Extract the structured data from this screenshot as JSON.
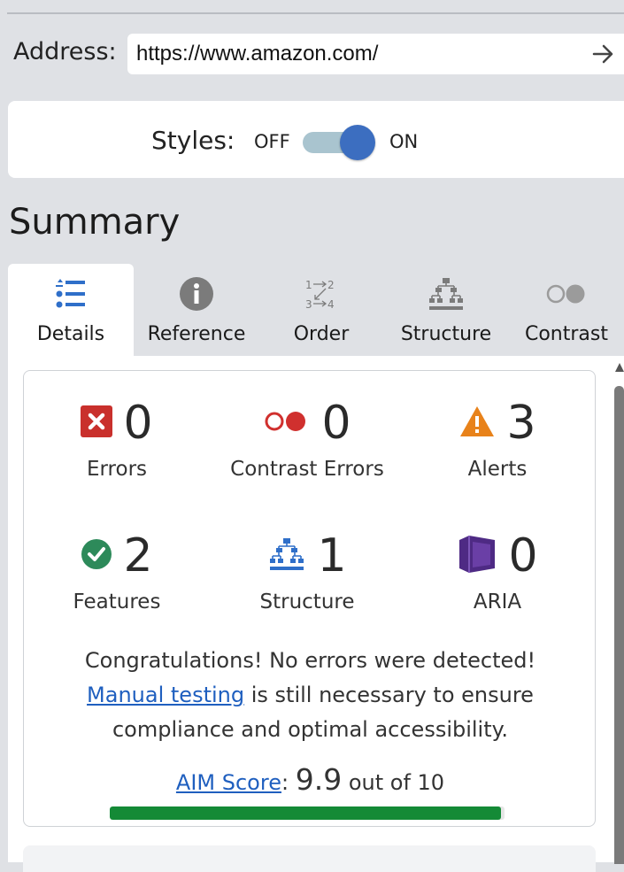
{
  "address": {
    "label": "Address:",
    "value": "https://www.amazon.com/",
    "go_icon": "arrow-right-icon"
  },
  "styles_toggle": {
    "label": "Styles:",
    "off_label": "OFF",
    "on_label": "ON",
    "state": "on"
  },
  "summary": {
    "title": "Summary"
  },
  "tabs": [
    {
      "label": "Details",
      "icon": "details-list-icon",
      "active": true
    },
    {
      "label": "Reference",
      "icon": "info-icon",
      "active": false
    },
    {
      "label": "Order",
      "icon": "order-icon",
      "active": false
    },
    {
      "label": "Structure",
      "icon": "structure-icon",
      "active": false
    },
    {
      "label": "Contrast",
      "icon": "contrast-icon",
      "active": false
    }
  ],
  "stats": [
    {
      "label": "Errors",
      "count": "0",
      "icon": "error-icon"
    },
    {
      "label": "Contrast Errors",
      "count": "0",
      "icon": "contrast-error-icon"
    },
    {
      "label": "Alerts",
      "count": "3",
      "icon": "alert-icon"
    },
    {
      "label": "Features",
      "count": "2",
      "icon": "feature-check-icon"
    },
    {
      "label": "Structure",
      "count": "1",
      "icon": "structure-element-icon"
    },
    {
      "label": "ARIA",
      "count": "0",
      "icon": "aria-cube-icon"
    }
  ],
  "message": {
    "congrats": "Congratulations! No errors were detected!",
    "manual_link": "Manual testing",
    "manual_rest": " is still necessary to ensure",
    "line3": "compliance and optimal accessibility."
  },
  "score": {
    "link": "AIM Score",
    "separator": ":",
    "value": "9.9",
    "suffix": "out of 10",
    "fraction": 0.99
  },
  "colors": {
    "toggle_knob": "#3c6ec0",
    "error_red": "#c9302c",
    "alert_orange": "#e8821a",
    "feature_green": "#2d8a5a",
    "structure_blue": "#2f6fc9",
    "aria_purple": "#4e2a84",
    "score_green": "#148a36",
    "link_blue": "#1f5fbf"
  }
}
